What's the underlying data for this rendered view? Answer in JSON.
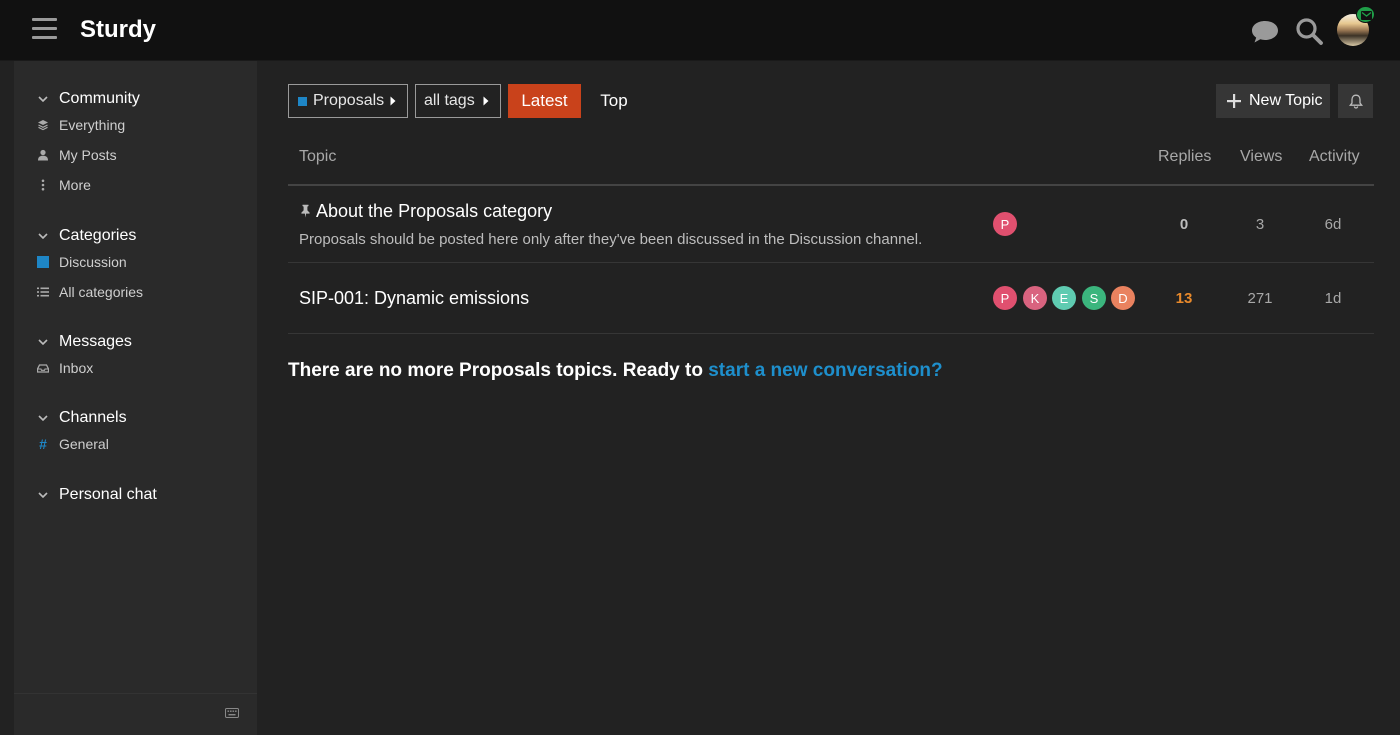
{
  "header": {
    "title": "Sturdy",
    "icons": [
      "hamburger-icon",
      "chat-icon",
      "search-icon",
      "avatar",
      "mail-icon"
    ],
    "colors": {
      "background": "#111111",
      "mail_badge": "#1f9e48"
    }
  },
  "sidebar": {
    "community": {
      "label": "Community",
      "items": [
        {
          "label": "Everything",
          "icon": "layers-icon"
        },
        {
          "label": "My Posts",
          "icon": "user-icon"
        },
        {
          "label": "More",
          "icon": "vertical-ellipsis-icon"
        }
      ]
    },
    "categories": {
      "label": "Categories",
      "items": [
        {
          "label": "Discussion",
          "icon": "category-swatch",
          "color": "#1e86c6"
        },
        {
          "label": "All categories",
          "icon": "list-icon"
        }
      ]
    },
    "messages": {
      "label": "Messages",
      "items": [
        {
          "label": "Inbox",
          "icon": "inbox-icon"
        }
      ]
    },
    "channels": {
      "label": "Channels",
      "items": [
        {
          "label": "General",
          "icon": "hash-icon",
          "color": "#1e86c6"
        }
      ]
    },
    "personal_chat": {
      "label": "Personal chat"
    }
  },
  "nav": {
    "category_dropdown": "Proposals",
    "category_color": "#1e86c6",
    "tags_dropdown": "all tags",
    "latest": "Latest",
    "latest_color": "#c9421b",
    "top": "Top",
    "new_topic": "New Topic"
  },
  "table": {
    "headers": {
      "topic": "Topic",
      "replies": "Replies",
      "views": "Views",
      "activity": "Activity"
    },
    "rows": [
      {
        "title": "About the Proposals category",
        "pinned": true,
        "excerpt": "Proposals should be posted here only after they've been discussed in the Discussion channel.",
        "posters": [
          {
            "letter": "P",
            "color": "#e0506f"
          }
        ],
        "replies": "0",
        "views": "3",
        "activity": "6d"
      },
      {
        "title": "SIP-001: Dynamic emissions",
        "pinned": false,
        "posters": [
          {
            "letter": "P",
            "color": "#e0506f"
          },
          {
            "letter": "K",
            "color": "#d9637f"
          },
          {
            "letter": "E",
            "color": "#5fcbb1"
          },
          {
            "letter": "S",
            "color": "#3bb57d"
          },
          {
            "letter": "D",
            "color": "#e9825f"
          }
        ],
        "replies": "13",
        "replies_color": "#e8892b",
        "views": "271",
        "activity": "1d"
      }
    ]
  },
  "footer": {
    "message": "There are no more Proposals topics. Ready to ",
    "link": "start a new conversation?"
  }
}
